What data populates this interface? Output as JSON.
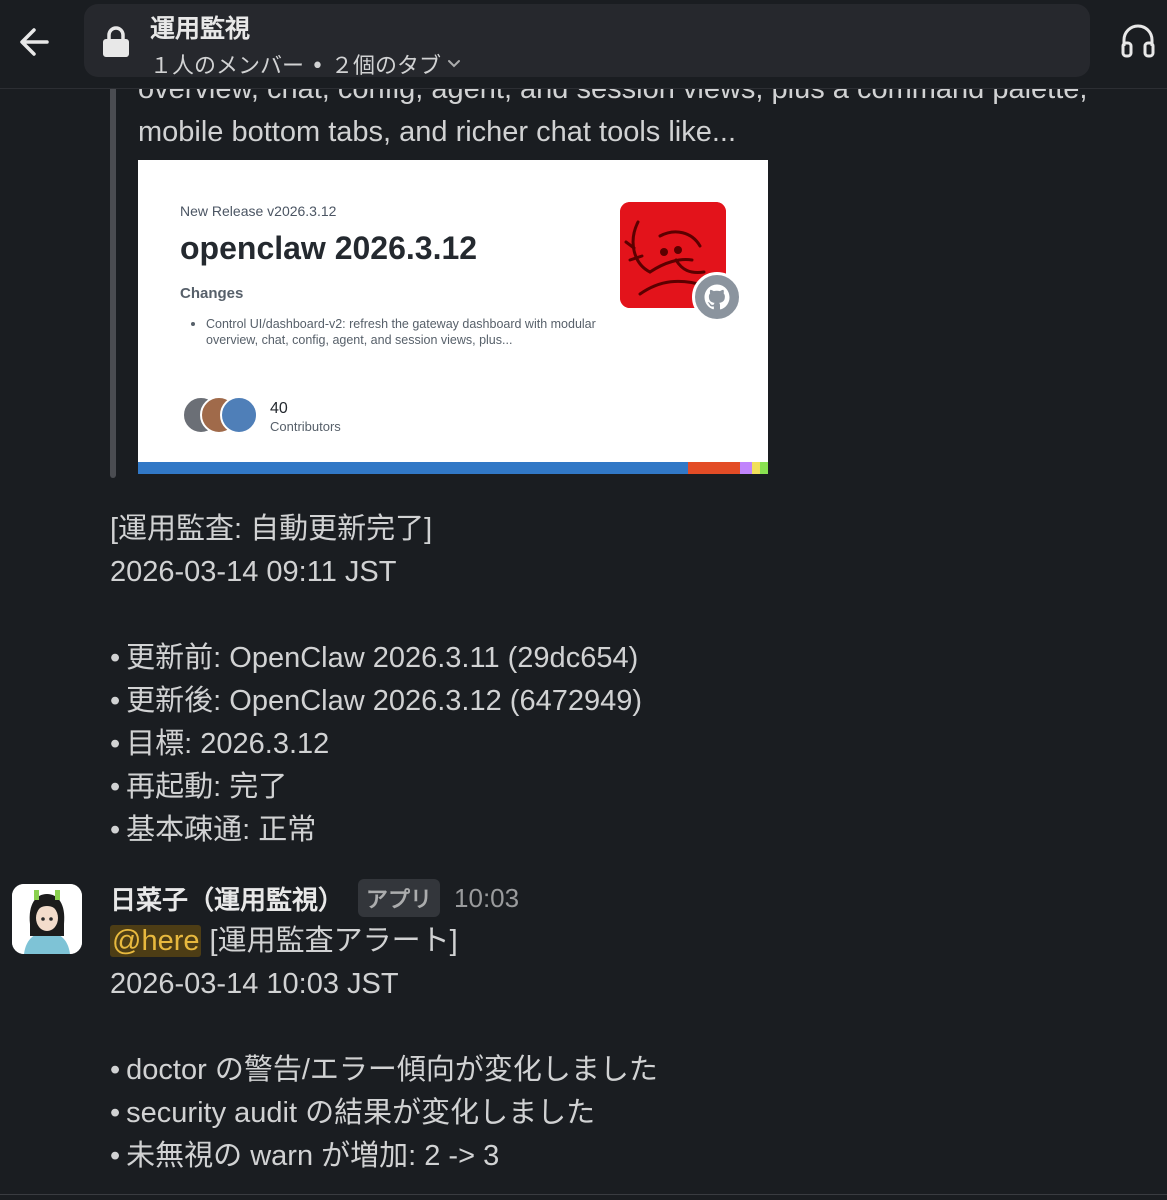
{
  "header": {
    "channel_name": "運用監視",
    "channel_meta": "１人のメンバー • ２個のタブ",
    "icons": [
      "back-arrow-icon",
      "lock-icon",
      "chevron-down-icon",
      "headphones-icon"
    ]
  },
  "unfurl": {
    "text_line1": "overview, chat, config, agent, and session views, plus a command palette,",
    "text_line2": "mobile bottom tabs, and richer chat tools like...",
    "preview": {
      "release_label": "New Release v2026.3.12",
      "title": "openclaw 2026.3.12",
      "changes_label": "Changes",
      "bullet": "Control UI/dashboard-v2: refresh the gateway dashboard with modular overview, chat, config, agent, and session views, plus...",
      "contributors_count": "40",
      "contributors_label": "Contributors",
      "stripe_colors": [
        "#3178c6",
        "#e34c26",
        "#c084fc",
        "#f1e05a",
        "#89e051"
      ]
    }
  },
  "message1": {
    "header": "[運用監査: 自動更新完了]",
    "timestamp": "2026-03-14 09:11 JST",
    "bullets": [
      "更新前: OpenClaw 2026.3.11 (29dc654)",
      "更新後: OpenClaw 2026.3.12 (6472949)",
      "目標: 2026.3.12",
      "再起動: 完了",
      "基本疎通: 正常"
    ]
  },
  "message2": {
    "sender": "日菜子（運用監視）",
    "badge": "アプリ",
    "time": "10:03",
    "mention": "@here",
    "header": "[運用監査アラート]",
    "timestamp": "2026-03-14 10:03 JST",
    "bullets": [
      "doctor の警告/エラー傾向が変化しました",
      "security audit の結果が変化しました",
      "未無視の warn が増加: 2 -> 3"
    ]
  },
  "bullet_char": "•",
  "colors": {
    "background": "#1a1d21",
    "text": "#d1d2d3",
    "mention_bg": "#4d3d15",
    "mention_fg": "#e8b93e"
  }
}
